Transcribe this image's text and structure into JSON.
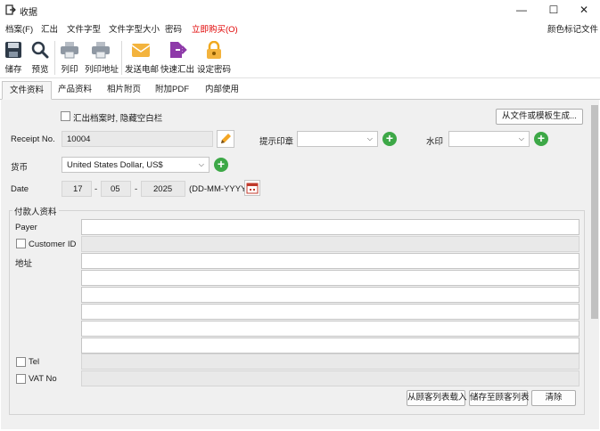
{
  "window": {
    "title": "收据",
    "minimize": "—",
    "maximize": "☐",
    "close": "✕"
  },
  "menu": {
    "items": [
      "档案(F)",
      "汇出",
      "文件字型",
      "文件字型大小",
      "密码",
      "立即购买(O)"
    ],
    "right": "颜色标记文件",
    "buy_color": "#e00000"
  },
  "toolbar": {
    "buttons": [
      {
        "label": "储存",
        "icon": "save-icon"
      },
      {
        "label": "预览",
        "icon": "preview-icon"
      },
      {
        "label": "列印",
        "icon": "print-icon"
      },
      {
        "label": "列印地址",
        "icon": "print-address-icon"
      },
      {
        "label": "发送电邮",
        "icon": "email-icon"
      },
      {
        "label": "快速汇出",
        "icon": "quick-export-icon"
      },
      {
        "label": "设定密码",
        "icon": "lock-icon"
      }
    ]
  },
  "tabs": [
    "文件资料",
    "产品资料",
    "相片附页",
    "附加PDF",
    "内部使用"
  ],
  "form": {
    "hide_blank_label": "汇出档案时, 隐藏空白栏",
    "generate_button": "从文件或模板生成...",
    "receipt_no_label": "Receipt No.",
    "receipt_no_value": "10004",
    "stamp_label": "提示印章",
    "stamp_value": "",
    "watermark_label": "水印",
    "watermark_value": "",
    "currency_label": "货币",
    "currency_value": "United States Dollar, US$",
    "date_label": "Date",
    "date_day": "17",
    "date_month": "05",
    "date_year": "2025",
    "date_sep": "-",
    "date_format": "(DD-MM-YYYY)"
  },
  "payer_group": {
    "title": "付款人资料",
    "payer_label": "Payer",
    "payer_value": "",
    "customer_id_label": "Customer ID",
    "address_label": "地址",
    "tel_label": "Tel",
    "vat_label": "VAT No",
    "load_button": "从顾客列表载入",
    "save_button": "储存至顾客列表",
    "clear_button": "清除"
  }
}
